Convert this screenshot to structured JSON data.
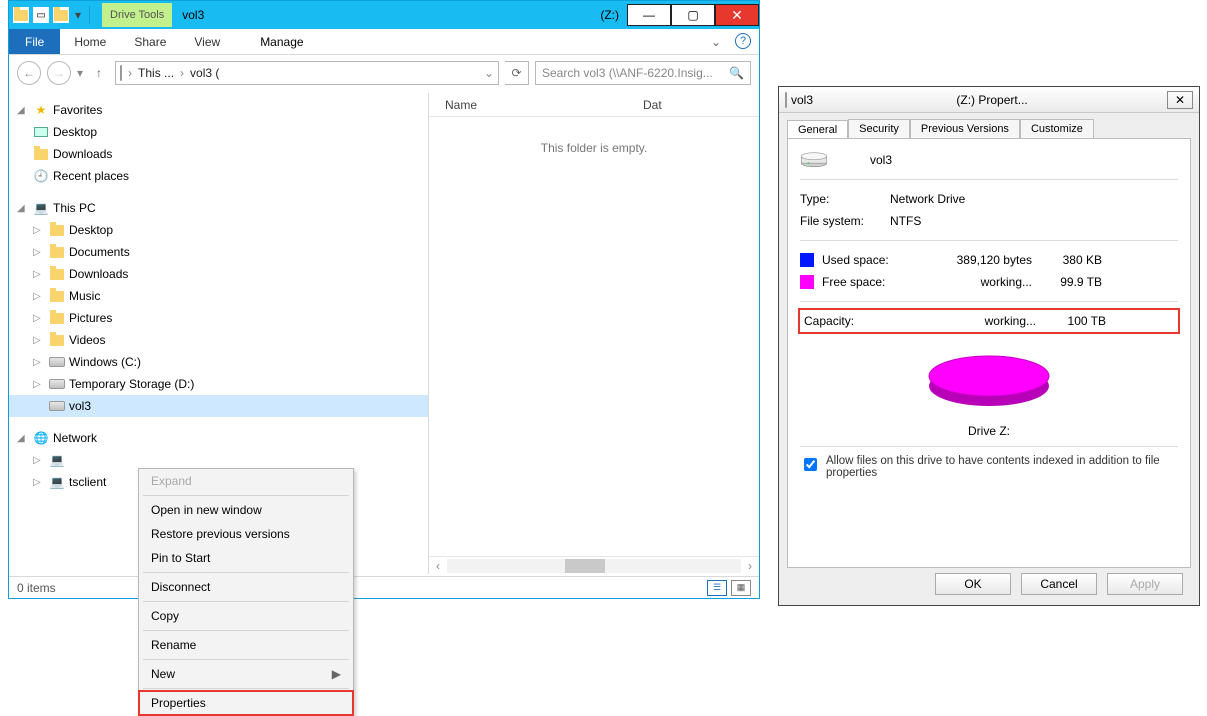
{
  "explorer": {
    "drive_tools_label": "Drive Tools",
    "title": "vol3",
    "drive_letter": "(Z:)",
    "ribbon": {
      "file": "File",
      "home": "Home",
      "share": "Share",
      "view": "View",
      "manage": "Manage"
    },
    "breadcrumb": {
      "this": "This ...",
      "vol": "vol3 ("
    },
    "search_placeholder": "Search vol3 (\\\\ANF-6220.Insig...",
    "columns": {
      "name": "Name",
      "date": "Dat"
    },
    "empty_text": "This folder is empty.",
    "status_items": "0 items",
    "tree": {
      "favorites": "Favorites",
      "desktop": "Desktop",
      "downloads": "Downloads",
      "recent": "Recent places",
      "thispc": "This PC",
      "pc_desktop": "Desktop",
      "documents": "Documents",
      "pc_downloads": "Downloads",
      "music": "Music",
      "pictures": "Pictures",
      "videos": "Videos",
      "cdrive": "Windows (C:)",
      "ddrive": "Temporary Storage (D:)",
      "vol3": "vol3",
      "network": "Network",
      "netnode": " ",
      "tsclient": "tsclient"
    }
  },
  "context_menu": {
    "expand": "Expand",
    "open_new": "Open in new window",
    "restore": "Restore previous versions",
    "pin": "Pin to Start",
    "disconnect": "Disconnect",
    "copy": "Copy",
    "rename": "Rename",
    "new": "New",
    "properties": "Properties"
  },
  "properties": {
    "title": "vol3",
    "title_suffix": "(Z:) Propert...",
    "tabs": {
      "general": "General",
      "security": "Security",
      "previous": "Previous Versions",
      "customize": "Customize"
    },
    "name": "vol3",
    "type_label": "Type:",
    "type_value": "Network Drive",
    "fs_label": "File system:",
    "fs_value": "NTFS",
    "used_label": "Used space:",
    "used_bytes": "389,120 bytes",
    "used_h": "380 KB",
    "free_label": "Free space:",
    "free_bytes": "working...",
    "free_h": "99.9 TB",
    "cap_label": "Capacity:",
    "cap_bytes": "working...",
    "cap_h": "100 TB",
    "drive_caption": "Drive Z:",
    "index_label": "Allow files on this drive to have contents indexed in addition to file properties",
    "ok": "OK",
    "cancel": "Cancel",
    "apply": "Apply",
    "colors": {
      "used": "#0018ff",
      "free": "#ff00ff"
    }
  }
}
